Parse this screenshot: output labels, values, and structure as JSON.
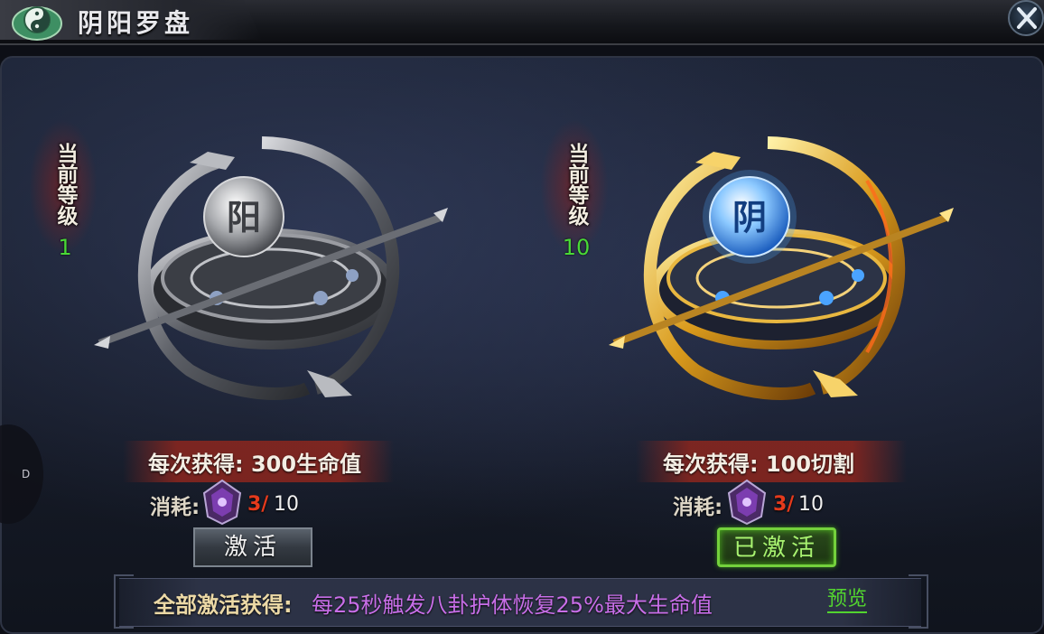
{
  "window": {
    "title": "阴阳罗盘",
    "close_icon": "close-icon"
  },
  "side": {
    "label": "D"
  },
  "compasses": [
    {
      "level_label": "当前等级",
      "level_value": "1",
      "orb_glyph": "阳",
      "style": "silver",
      "reward_text": "每次获得: 300生命值",
      "cost_label": "消耗:",
      "cost_icon": "purple-crystal-icon",
      "cost_have": "3/",
      "cost_need": "10",
      "button_label": "激活"
    },
    {
      "level_label": "当前等级",
      "level_value": "10",
      "orb_glyph": "阴",
      "style": "gold",
      "reward_text": "每次获得: 100切割",
      "cost_label": "消耗:",
      "cost_icon": "purple-crystal-icon",
      "cost_have": "3/",
      "cost_need": "10",
      "button_label": "已激活"
    }
  ],
  "footer": {
    "bonus_label": "全部激活获得:",
    "bonus_effect": "每25秒触发八卦护体恢复25%最大生命值",
    "preview_link": "预览"
  },
  "colors": {
    "level_value": "#49d936",
    "cost_have": "#e53a1c",
    "bonus_effect": "#c86ee8",
    "activated_button": "#74d13c"
  }
}
